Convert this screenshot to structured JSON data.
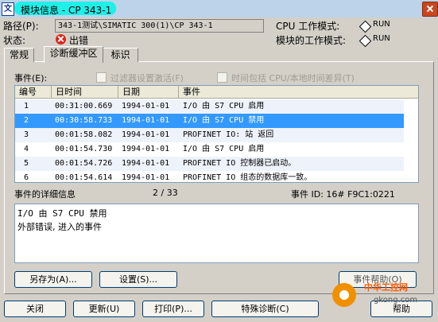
{
  "window": {
    "title": "模块信息 - CP 343-1",
    "app_icon": "文"
  },
  "info": {
    "path_label": "路径(P):",
    "path_value": "343-1测试\\SIMATIC 300(1)\\CP 343-1",
    "state_label": "状态:",
    "state_value": "出错",
    "cpu_mode_label": "CPU 工作模式:",
    "cpu_mode_value": "RUN",
    "module_mode_label": "模块的工作模式:",
    "module_mode_value": "RUN"
  },
  "tabs": [
    {
      "label": "常规",
      "active": false
    },
    {
      "label": "诊断缓冲区",
      "active": true
    },
    {
      "label": "标识",
      "active": false
    }
  ],
  "events": {
    "label": "事件(E):",
    "filter_label": "过滤器设置激活(F)",
    "time_diff_label": "时间包括 CPU/本地时间差异(T)",
    "columns": [
      "编号",
      "日时间",
      "日期",
      "事件"
    ],
    "rows": [
      {
        "no": "1",
        "time": "00:31:00.669",
        "date": "1994-01-01",
        "event": "I/O 由 S7 CPU 启用"
      },
      {
        "no": "2",
        "time": "00:30:58.733",
        "date": "1994-01-01",
        "event": "I/O 由 S7 CPU 禁用"
      },
      {
        "no": "3",
        "time": "00:01:58.082",
        "date": "1994-01-01",
        "event": "PROFINET IO: 站 返回"
      },
      {
        "no": "4",
        "time": "00:01:54.730",
        "date": "1994-01-01",
        "event": "I/O 由 S7 CPU 启用"
      },
      {
        "no": "5",
        "time": "00:01:54.726",
        "date": "1994-01-01",
        "event": "PROFINET IO 控制器已启动。"
      },
      {
        "no": "6",
        "time": "00:01:54.614",
        "date": "1994-01-01",
        "event": "PROFINET IO 组态的数据库一致。"
      }
    ],
    "selected_row": 1
  },
  "details": {
    "label": "事件的详细信息",
    "counter": "2 / 33",
    "event_id": "事件 ID: 16# F9C1:0221",
    "lines": [
      "I/O 由 S7 CPU 禁用",
      "外部错误, 进入的事件"
    ]
  },
  "panel_buttons": {
    "save_as": "另存为(A)...",
    "settings": "设置(S)...",
    "event_help": "事件帮助(O)"
  },
  "footer_buttons": {
    "close": "关闭",
    "refresh": "更新(U)",
    "print": "打印(P)...",
    "special_diag": "特殊诊断(C)",
    "help": "帮助"
  },
  "watermark": {
    "text": "中华工控网",
    "url": "gkong.com"
  },
  "colors": {
    "selection": "#3399ff",
    "title_highlight": "#1ef0e8",
    "error_red": "#d9261c"
  }
}
